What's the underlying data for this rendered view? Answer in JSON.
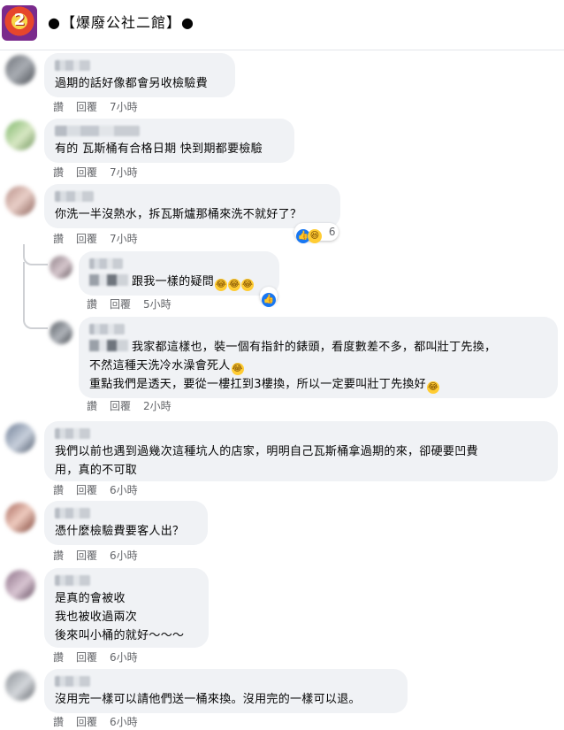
{
  "group": {
    "title": "●【爆廢公社二館】●",
    "logo_text": "2"
  },
  "comments": [
    {
      "text": "過期的話好像都會另收檢驗費",
      "actions": {
        "like": "讚",
        "reply": "回覆",
        "time": "7小時"
      }
    },
    {
      "text": "有的 瓦斯桶有合格日期 快到期都要檢驗",
      "actions": {
        "like": "讚",
        "reply": "回覆",
        "time": "7小時"
      }
    },
    {
      "text": "你洗一半沒熱水，拆瓦斯爐那桶來洗不就好了？",
      "actions": {
        "like": "讚",
        "reply": "回覆",
        "time": "7小時"
      },
      "reaction_count": "6"
    },
    {
      "text": "跟我一樣的疑問",
      "actions": {
        "like": "讚",
        "reply": "回覆",
        "time": "5小時"
      }
    },
    {
      "text": "我家都這樣也，裝一個有指針的錶頭，看度數差不多，都叫壯丁先換，",
      "text2": "不然這種天洗冷水澡會死人",
      "text3": "重點我們是透天，要從一樓扛到3樓換，所以一定要叫壯丁先換好",
      "actions": {
        "like": "讚",
        "reply": "回覆",
        "time": "2小時"
      }
    },
    {
      "text": "我們以前也遇到過幾次這種坑人的店家，明明自己瓦斯桶拿過期的來，卻硬要凹費",
      "text2": "用，真的不可取",
      "actions": {
        "like": "讚",
        "reply": "回覆",
        "time": "6小時"
      }
    },
    {
      "text": "憑什麼檢驗費要客人出？",
      "actions": {
        "like": "讚",
        "reply": "回覆",
        "time": "6小時"
      }
    },
    {
      "text": "是真的會被收",
      "text2": "我也被收過兩次",
      "text3": "後來叫小桶的就好～～～",
      "actions": {
        "like": "讚",
        "reply": "回覆",
        "time": "6小時"
      }
    },
    {
      "text": "沒用完一樣可以請他們送一桶來換。沒用完的一樣可以退。",
      "actions": {
        "like": "讚",
        "reply": "回覆",
        "time": "6小時"
      }
    }
  ]
}
